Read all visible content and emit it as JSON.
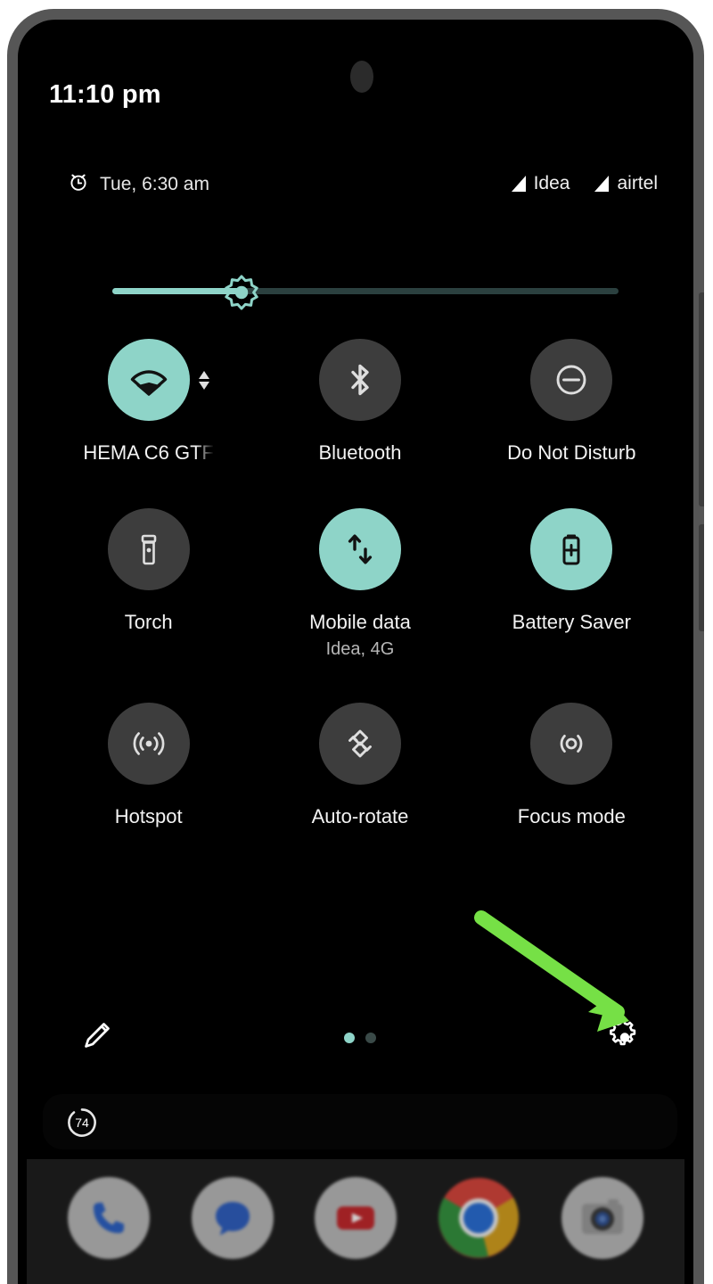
{
  "device": {
    "frame_color": "#565656",
    "screen_bg": "#000000"
  },
  "status_bar": {
    "clock": "11:10 pm"
  },
  "quick_settings": {
    "header": {
      "alarm_icon": "alarm-clock-icon",
      "alarm_text": "Tue, 6:30 am",
      "carriers": [
        {
          "icon": "signal-bars-icon",
          "label": "Idea"
        },
        {
          "icon": "signal-bars-icon",
          "label": "airtel"
        }
      ]
    },
    "brightness": {
      "icon": "brightness-sun-icon",
      "value_percent": 26,
      "fill_color": "#8ed4c8",
      "track_color": "#2b403f"
    },
    "accent_color": "#8ed4c8",
    "inactive_color": "#3d3d3d",
    "tiles": [
      {
        "icon": "wifi-icon",
        "label": "HEMA C6 GTF",
        "sublabel": "",
        "active": true,
        "has_expand": true,
        "clipped": true
      },
      {
        "icon": "bluetooth-icon",
        "label": "Bluetooth",
        "sublabel": "",
        "active": false,
        "has_expand": false,
        "clipped": false
      },
      {
        "icon": "do-not-disturb-icon",
        "label": "Do Not Disturb",
        "sublabel": "",
        "active": false,
        "has_expand": false,
        "clipped": false
      },
      {
        "icon": "flashlight-icon",
        "label": "Torch",
        "sublabel": "",
        "active": false,
        "has_expand": false,
        "clipped": false
      },
      {
        "icon": "mobile-data-icon",
        "label": "Mobile data",
        "sublabel": "Idea, 4G",
        "active": true,
        "has_expand": false,
        "clipped": false
      },
      {
        "icon": "battery-saver-icon",
        "label": "Battery Saver",
        "sublabel": "",
        "active": true,
        "has_expand": false,
        "clipped": false
      },
      {
        "icon": "hotspot-icon",
        "label": "Hotspot",
        "sublabel": "",
        "active": false,
        "has_expand": false,
        "clipped": false
      },
      {
        "icon": "auto-rotate-icon",
        "label": "Auto-rotate",
        "sublabel": "",
        "active": false,
        "has_expand": false,
        "clipped": false
      },
      {
        "icon": "focus-mode-icon",
        "label": "Focus mode",
        "sublabel": "",
        "active": false,
        "has_expand": false,
        "clipped": false
      }
    ],
    "footer": {
      "edit_icon": "pencil-edit-icon",
      "settings_icon": "gear-settings-icon",
      "page_dots": [
        {
          "active": true
        },
        {
          "active": false
        }
      ]
    }
  },
  "notification_shade": {
    "badge_count": "74",
    "badge_icon": "circle-progress-badge-icon"
  },
  "home_screen": {
    "dock": [
      {
        "icon": "phone-icon",
        "label": "Phone"
      },
      {
        "icon": "messages-icon",
        "label": "Messages"
      },
      {
        "icon": "youtube-icon",
        "label": "YouTube"
      },
      {
        "icon": "chrome-icon",
        "label": "Chrome"
      },
      {
        "icon": "camera-icon",
        "label": "Camera"
      }
    ]
  },
  "annotation": {
    "arrow_color": "#76e046",
    "points_to": "gear-settings-icon"
  }
}
